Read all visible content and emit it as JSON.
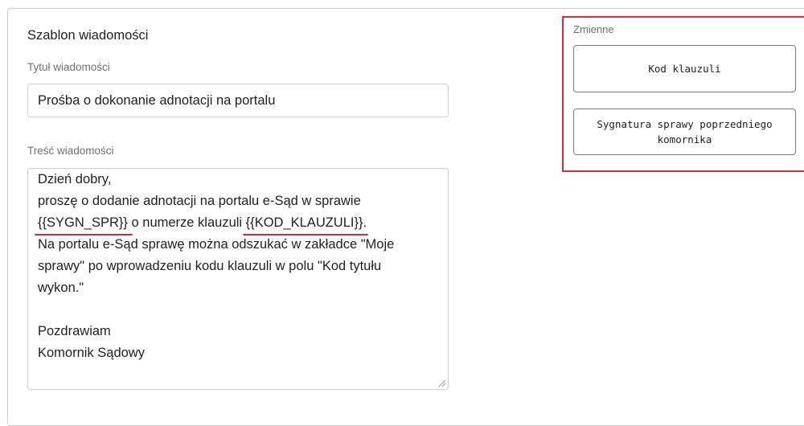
{
  "template": {
    "section_title": "Szablon wiadomości",
    "title_label": "Tytuł wiadomości",
    "title_value": "Prośba o dokonanie adnotacji na portalu",
    "body_label": "Treść wiadomości",
    "body": {
      "line1": "Dzień dobry,",
      "line2": "proszę o dodanie adnotacji na portalu e-Sąd w sprawie",
      "line3_token1": "{{SYGN_SPR}}",
      "line3_mid": " o numerze klauzuli ",
      "line3_token2": "{{KOD_KLAUZULI}}",
      "line3_end": ".",
      "line4": "Na portalu e-Sąd sprawę można odszukać w zakładce \"Moje",
      "line5": "sprawy\" po wprowadzeniu kodu klauzuli w polu \"Kod tytułu",
      "line6": "wykon.\"",
      "line7": "",
      "line8": "Pozdrawiam",
      "line9": "Komornik Sądowy"
    }
  },
  "variables": {
    "label": "Zmienne",
    "buttons": [
      {
        "label": "Kod klauzuli"
      },
      {
        "label": "Sygnatura sprawy poprzedniego komornika"
      }
    ]
  },
  "colors": {
    "highlight": "#e2283a",
    "underline": "#d8283a"
  }
}
